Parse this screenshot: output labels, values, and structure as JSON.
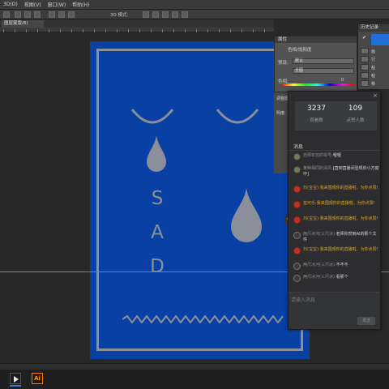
{
  "menubar": {
    "items": [
      "3D(D)",
      "视图(V)",
      "窗口(W)",
      "帮助(H)"
    ]
  },
  "options_bar": {
    "mode_3d": "3D 模式:"
  },
  "document": {
    "tab_label": "图层蒙版/8)"
  },
  "poster": {
    "letters": [
      "S",
      "A",
      "D"
    ],
    "background_color": "#0840a4",
    "line_color": "#8a8f9b"
  },
  "properties_panel": {
    "title": "属性",
    "subtitle": "色相/饱和度",
    "preset_label": "预设:",
    "preset_value": "默认",
    "channel_value": "全图",
    "hue_label": "色相:",
    "hue_value": "0"
  },
  "adjust_strip": {
    "label_top": "调整图",
    "label_mid": "明度:"
  },
  "history_panel": {
    "title": "历史记录",
    "items": [
      "画",
      "行",
      "粘",
      "粘",
      "移"
    ]
  },
  "live_chat": {
    "stats": [
      {
        "value": "3237",
        "label": "观看数"
      },
      {
        "value": "109",
        "label": "点赞人数"
      }
    ],
    "section_title": "消息",
    "messages": [
      {
        "nick": "自那年迈的零号:",
        "text": "哩哩",
        "style": "normal",
        "avatar": "photo"
      },
      {
        "nick": "某种相同的清风:",
        "text": "[直到直播间显现你小方窗中]",
        "style": "normal",
        "avatar": "photo"
      },
      {
        "nick": "刘(宝宝):",
        "text": "我来围观你的直播啦，为你点赞!",
        "style": "yellow",
        "avatar": "red"
      },
      {
        "nick": "蓝可乐:",
        "text": "我来围观你的直播啦，为你点赞!",
        "style": "yellow",
        "avatar": "red"
      },
      {
        "nick": "刘(宝宝):",
        "text": "我来围观你的直播啦，为你点赞!",
        "style": "yellow",
        "avatar": "red"
      },
      {
        "nick": "两尺冰河(三尺冰):",
        "text": "老师你然到AI的那个文件",
        "style": "normal",
        "avatar": "ghost"
      },
      {
        "nick": "刘(宝宝):",
        "text": "我来围观你的直播啦，为你点赞!",
        "style": "yellow",
        "avatar": "red"
      },
      {
        "nick": "两尺冰河(三尺冰):",
        "text": "不不不",
        "style": "normal",
        "avatar": "ghost"
      },
      {
        "nick": "两尺冰河(三尺冰):",
        "text": "看那个",
        "style": "normal",
        "avatar": "ghost"
      }
    ],
    "input_placeholder": "请输入消息",
    "send_label": "发送",
    "close_glyph": "×",
    "collapse_glyph": "‹"
  },
  "taskbar": {
    "apps": [
      {
        "name": "media-player-app",
        "glyph": ""
      },
      {
        "name": "illustrator-app",
        "glyph": "Ai"
      }
    ]
  }
}
